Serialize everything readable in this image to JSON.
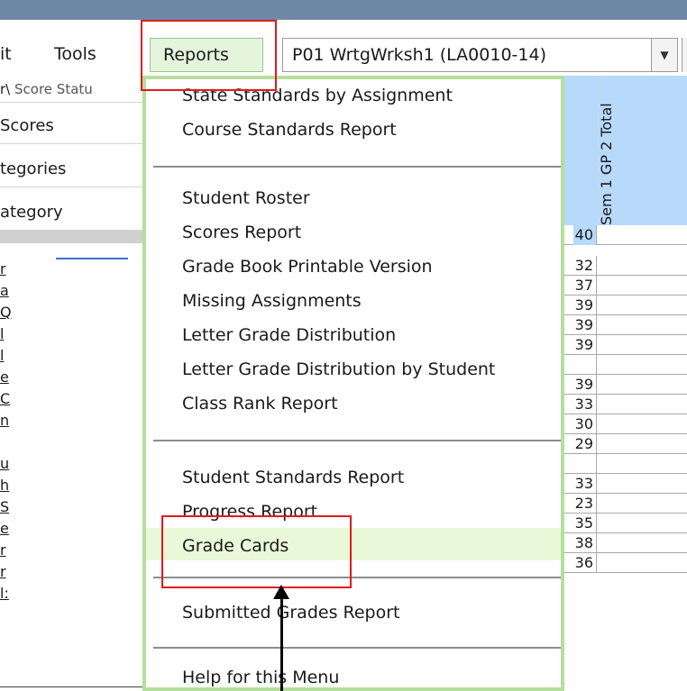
{
  "menu": {
    "edit": "it",
    "tools": "Tools",
    "reports": "Reports",
    "class_selector": "P01  WrtgWrksh1 (LA0010-14)"
  },
  "left_panel": {
    "tab_top_prefix": "r\\",
    "tab_top_label": "Score Statu",
    "rows": [
      "Scores",
      "tegories",
      "ategory"
    ],
    "list_rows": [
      "r",
      "a",
      "Q",
      "l",
      "l",
      "e",
      "C",
      "n",
      "",
      "u",
      "h",
      "S",
      "e",
      "r",
      "r",
      "l:"
    ]
  },
  "dropdown": {
    "items": [
      "State Standards by Assignment",
      "Course Standards Report",
      "Student Roster",
      "Scores Report",
      "Grade Book Printable Version",
      "Missing Assignments",
      "Letter Grade Distribution",
      "Letter Grade Distribution by Student",
      "Class Rank Report",
      "Student Standards Report",
      "Progress Report",
      "Grade Cards",
      "Submitted Grades Report",
      "Help for this Menu"
    ]
  },
  "grid": {
    "header": "Sem 1 GP 2 Total",
    "scores": [
      "40",
      "32",
      "37",
      "39",
      "39",
      "39",
      "",
      "39",
      "33",
      "30",
      "29",
      "",
      "33",
      "23",
      "35",
      "38",
      "36"
    ]
  },
  "colors": {
    "title_bar": "#6f88a8",
    "dropdown_border": "#b6de9d",
    "highlight": "#e8f8d8",
    "header": "#b7d9fa",
    "annotation": "#e11b1b"
  }
}
